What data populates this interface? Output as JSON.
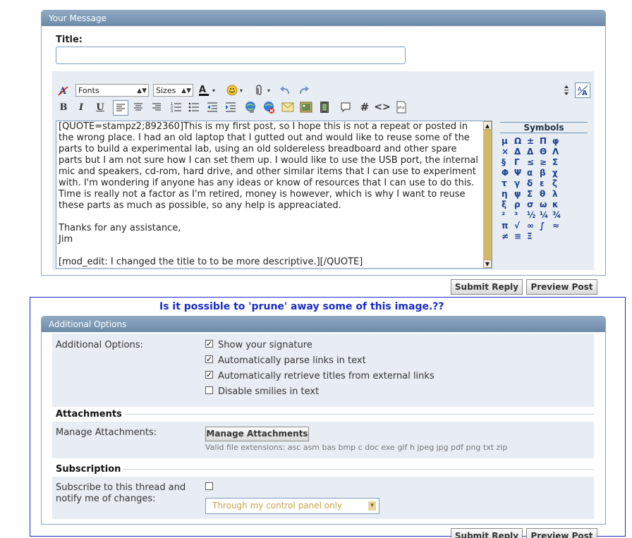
{
  "message_panel": {
    "header": "Your Message",
    "title_label": "Title:",
    "title_value": "",
    "toolbar": {
      "font_select": "Fonts",
      "size_select": "Sizes",
      "buttons_row1": [
        "remove-format",
        "font-color",
        "smilies",
        "attachment",
        "undo",
        "redo"
      ],
      "buttons_row2": [
        "bold",
        "italic",
        "underline",
        "align-left",
        "align-center",
        "align-right",
        "ordered-list",
        "unordered-list",
        "outdent",
        "indent",
        "link",
        "unlink",
        "email",
        "image",
        "video",
        "quote",
        "hash",
        "code",
        "php"
      ]
    },
    "body_text": "[QUOTE=stampz2;892360]This is my first post, so I hope this is not a repeat or posted in the wrong place. I had an old laptop that I gutted out and would like to reuse some of the parts to build a experimental lab, using an old soldereless breadboard and other spare parts but I am not sure how I can set them up. I would like to use the USB port, the internal mic and speakers, cd-rom, hard drive, and other similar items that I can use to experiment with. I'm wondering if anyone has any ideas or know of resources that I can use to do this. Time is really not a factor as I'm retired, money is however, which is why I want to reuse these parts as much as possible, so any help is appreaciated.\n\nThanks for any assistance,\nJim\n\n[mod_edit: I changed the title to to be more descriptive.][/QUOTE]",
    "symbols_title": "Symbols",
    "symbols": [
      "μ",
      "Ω",
      "±",
      "Π",
      "φ",
      "×",
      "Δ",
      "Δ",
      "Θ",
      "Λ",
      "§",
      "Γ",
      "≤",
      "≥",
      "Σ",
      "Φ",
      "Ψ",
      "α",
      "β",
      "χ",
      "τ",
      "γ",
      "δ",
      "ε",
      "ζ",
      "η",
      "ψ",
      "Σ",
      "θ",
      "λ",
      "ξ",
      "ρ",
      "σ",
      "ω",
      "κ",
      "²",
      "³",
      "½",
      "¼",
      "¾",
      "π",
      "√",
      "∞",
      "∫",
      "≈",
      "≠",
      "≡",
      "Ξ"
    ]
  },
  "buttons": {
    "submit": "Submit Reply",
    "preview": "Preview Post"
  },
  "annotation": "Is it possible to 'prune' away some of this image.??",
  "additional_options": {
    "header": "Additional Options",
    "label": "Additional Options:",
    "options": [
      {
        "label": "Show your signature",
        "checked": true
      },
      {
        "label": "Automatically parse links in text",
        "checked": true
      },
      {
        "label": "Automatically retrieve titles from external links",
        "checked": true
      },
      {
        "label": "Disable smilies in text",
        "checked": false
      }
    ],
    "attachments_title": "Attachments",
    "manage_label": "Manage Attachments:",
    "manage_button": "Manage Attachments",
    "extensions": "Valid file extensions: asc asm bas bmp c doc exe gif h jpeg jpg pdf png txt zip",
    "subscription_title": "Subscription",
    "subscribe_label": "Subscribe to this thread and notify me of changes:",
    "subscribe_select": "Through my control panel only"
  },
  "colors": {
    "annotation": "#1a2cc7",
    "panel_header": "#7f9bb8",
    "border_box": "#1a2cc7"
  }
}
